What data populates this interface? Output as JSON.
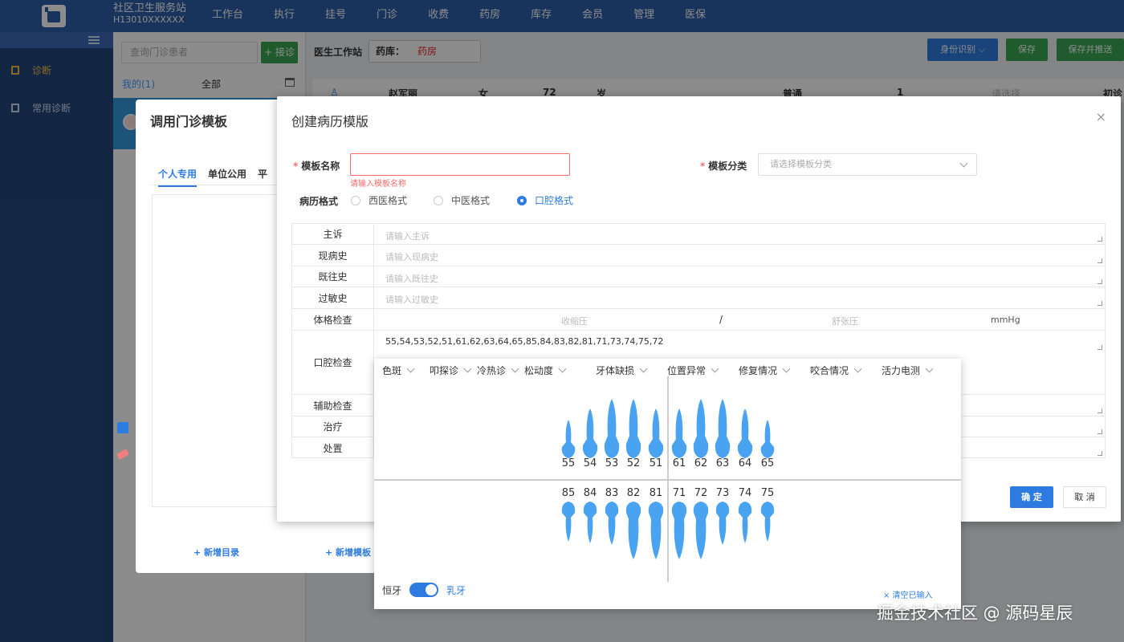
{
  "colors": {
    "nav": "#2d5da8",
    "sidebar": "#24477e",
    "primary": "#2d7be0",
    "success": "#3aa652",
    "danger": "#f56c6c",
    "tooth": "#4aa3f0"
  },
  "header": {
    "station_name": "社区卫生服务站",
    "station_code": "H13010XXXXXX",
    "menu": [
      "工作台",
      "执行",
      "挂号",
      "门诊",
      "收费",
      "药房",
      "库存",
      "会员",
      "管理",
      "医保"
    ]
  },
  "sidebar": {
    "items": [
      {
        "label": "诊断"
      },
      {
        "label": "常用诊断"
      }
    ]
  },
  "patient_panel": {
    "search_placeholder": "查询门诊患者",
    "add_button": "+ 接诊",
    "tab_mine": "我的(1)",
    "tab_all": "全部"
  },
  "workspace": {
    "title": "医生工作站",
    "pharmacy_label": "药库：",
    "pharmacy_value": "药房",
    "btn_id": "身份识别",
    "btn_save": "保存",
    "btn_save_push": "保存并推送",
    "patient": {
      "name": "赵军丽",
      "gender": "女",
      "age": "72",
      "age_unit": "岁",
      "type": "普通",
      "num": "1",
      "select": "请选择",
      "visit": "初诊"
    }
  },
  "template_dialog": {
    "title": "调用门诊模板",
    "tabs": [
      "个人专用",
      "单位公用",
      "平"
    ],
    "add_dir": "+ 新增目录",
    "add_tpl": "+ 新增模板"
  },
  "dialog": {
    "title": "创建病历模版",
    "close": "×",
    "name_label": "模板名称",
    "name_error": "请输入模板名称",
    "category_label": "模板分类",
    "category_placeholder": "请选择模板分类",
    "format_label": "病历格式",
    "formats": [
      "西医格式",
      "中医格式",
      "口腔格式"
    ],
    "selected_format": "口腔格式",
    "rows": [
      {
        "label": "主诉",
        "placeholder": "请输入主诉"
      },
      {
        "label": "现病史",
        "placeholder": "请输入现病史"
      },
      {
        "label": "既往史",
        "placeholder": "请输入既往史"
      },
      {
        "label": "过敏史",
        "placeholder": "请输入过敏史"
      }
    ],
    "vitals": {
      "label": "体格检查",
      "systolic": "收缩压",
      "sep": "/",
      "diastolic": "舒张压",
      "unit": "mmHg"
    },
    "oral": {
      "label": "口腔检查",
      "value": "55,54,53,52,51,61,62,63,64,65,85,84,83,82,81,71,73,74,75,72"
    },
    "aux_label": "辅助检查",
    "treat_label": "治疗",
    "dispose_label": "处置",
    "ok": "确 定",
    "cancel": "取 消"
  },
  "teeth_panel": {
    "filters": [
      "色斑",
      "叩探诊",
      "冷热诊",
      "松动度",
      "牙体缺损",
      "位置异常",
      "修复情况",
      "咬合情况",
      "活力电测"
    ],
    "upper": [
      "55",
      "54",
      "53",
      "52",
      "51",
      "61",
      "62",
      "63",
      "64",
      "65"
    ],
    "lower": [
      "85",
      "84",
      "83",
      "82",
      "81",
      "71",
      "72",
      "73",
      "74",
      "75"
    ],
    "toggle_left": "恒牙",
    "toggle_right": "乳牙",
    "toggle_on": true,
    "clear": "× 清空已输入"
  },
  "watermark": "掘金技术社区 @ 源码星辰"
}
